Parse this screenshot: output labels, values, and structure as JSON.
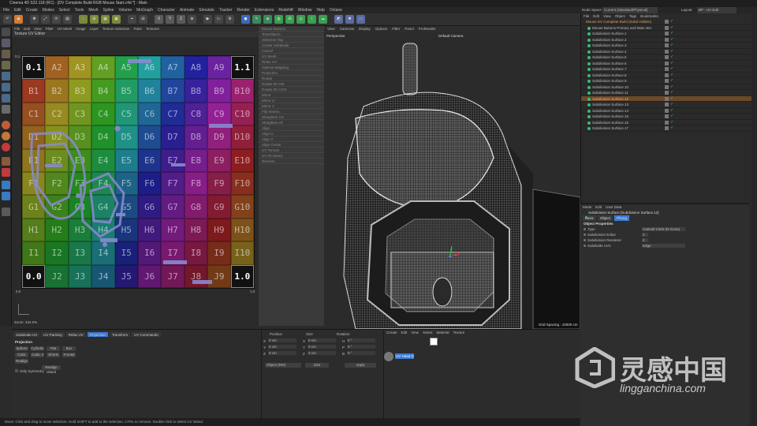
{
  "window": {
    "title": "Cinema 4D S22.118 (RC) - [DV Complete Build RGB Mouse Start.c4d *] - Main"
  },
  "menu": [
    "File",
    "Edit",
    "Create",
    "Modes",
    "Select",
    "Tools",
    "Mesh",
    "Spline",
    "Volume",
    "MoGraph",
    "Character",
    "Animate",
    "Simulate",
    "Tracker",
    "Render",
    "Extensions",
    "Redshift",
    "Window",
    "Help",
    "Octane"
  ],
  "layout": {
    "node_space_label": "Node Space",
    "node_space_value": "Current (Standard/Physical)",
    "layout_label": "Layout",
    "layout_value": "BP - UV Edit"
  },
  "toolbar": {
    "x": "X",
    "y": "Y",
    "z": "Z"
  },
  "uv_editor": {
    "menu": [
      "File",
      "Edit",
      "View",
      "Filter",
      "UV Mesh",
      "Image",
      "Layer",
      "Texture Selection",
      "Paint",
      "Textures"
    ],
    "title": "Texture UV Editor",
    "rows": [
      [
        "0.1",
        "A2",
        "A3",
        "A4",
        "A5",
        "A6",
        "A7",
        "A8",
        "A9",
        "1.1"
      ],
      [
        "B1",
        "B2",
        "B3",
        "B4",
        "B5",
        "B6",
        "B7",
        "B8",
        "B9",
        "B10"
      ],
      [
        "C1",
        "C2",
        "C3",
        "C4",
        "C5",
        "C6",
        "C7",
        "C8",
        "C9",
        "C10"
      ],
      [
        "D1",
        "D2",
        "D3",
        "D4",
        "D5",
        "D6",
        "D7",
        "D8",
        "D9",
        "D10"
      ],
      [
        "E1",
        "E2",
        "E3",
        "E4",
        "E5",
        "E6",
        "E7",
        "E8",
        "E9",
        "E10"
      ],
      [
        "F1",
        "F2",
        "F3",
        "F4",
        "F5",
        "F6",
        "F7",
        "F8",
        "F9",
        "F10"
      ],
      [
        "G1",
        "G2",
        "G3",
        "G4",
        "G5",
        "G6",
        "G7",
        "G8",
        "G9",
        "G10"
      ],
      [
        "H1",
        "H2",
        "H3",
        "H4",
        "H5",
        "H6",
        "H7",
        "H8",
        "H9",
        "H10"
      ],
      [
        "I1",
        "I2",
        "I3",
        "I4",
        "I5",
        "I6",
        "I7",
        "I8",
        "I9",
        "I10"
      ],
      [
        "0.0",
        "J2",
        "J3",
        "J4",
        "J5",
        "J6",
        "J7",
        "J8",
        "J9",
        "1.0"
      ]
    ],
    "axis": {
      "top_left": "0,1",
      "bottom_left": "0,0",
      "bottom_right": "1,0",
      "top_right": "1,1"
    },
    "zoom": "Zoom: 234.0%"
  },
  "mid_panel": {
    "items": [
      "Mouse Buttons",
      "Tessellation",
      "Selection Tag",
      "Create Subdivide",
      "Cancel",
      "UV Mesh",
      "Relax UV",
      "Optimal Mapping",
      "Projection",
      "Rotate",
      "Rotate 90 CW",
      "Rotate 90 CCW",
      "Mirror",
      "Mirror U",
      "Mirror V",
      "Flip Seams",
      "Straighten UV",
      "Straighten All",
      "Align",
      "Align U",
      "Align V",
      "Align Center",
      "UV Terrace",
      "UV Fit Island",
      "Reverse"
    ]
  },
  "viewport": {
    "menu": [
      "View",
      "Cameras",
      "Display",
      "Options",
      "Filter",
      "Panel",
      "ProRender"
    ],
    "label": "Perspective",
    "camera": "Default Camera",
    "grid": "Grid Spacing : 10000 cm"
  },
  "objects": {
    "menu": [
      "File",
      "Edit",
      "View",
      "Object",
      "Tags",
      "Bookmarks"
    ],
    "rows": [
      "Mouse DV Complete Build (Subd Hidden)",
      "Mouse Buttons Primary and Main ster",
      "Subdivision Surface.1",
      "Subdivision Surface.2",
      "Subdivision Surface.3",
      "Subdivision Surface.4",
      "Subdivision Surface.5",
      "Subdivision Surface.6",
      "Subdivision Surface.7",
      "Subdivision Surface.8",
      "Subdivision Surface.9",
      "Subdivision Surface.10",
      "Subdivision Surface.11",
      "Subdivision Surface.12",
      "Subdivision Surface.13",
      "Subdivision Surface.14",
      "Subdivision Surface.15",
      "Subdivision Surface.16",
      "Subdivision Surface.17"
    ],
    "selected_index": 13
  },
  "attributes": {
    "menu": [
      "Mode",
      "Edit",
      "User Data"
    ],
    "header": "Subdivision Surface [Subdivision Surface.12]",
    "tabs": [
      "Basic",
      "Object",
      "Phong"
    ],
    "active_tab": "Phong",
    "section": "Object Properties",
    "props": [
      {
        "label": "Type",
        "value": "Catmull-Clark (N-Gons)"
      },
      {
        "label": "Subdivision Editor",
        "value": "2"
      },
      {
        "label": "Subdivision Renderer",
        "value": "2"
      },
      {
        "label": "Subdivide UVs",
        "value": "Edge"
      }
    ]
  },
  "uv_tabs": {
    "items": [
      "Subdivide UV",
      "UV Packing",
      "Relax UV",
      "Projection",
      "Transform",
      "UV Commands"
    ],
    "active": "Projection",
    "section": "Projection",
    "buttons": [
      "Sphere",
      "Cylinder",
      "Flat",
      "Box",
      "Cubic",
      "Cubic 2",
      "Shrink",
      "Frontal",
      "Realign"
    ],
    "checkbox": "Only Symmetry",
    "pack_label": "Realign Island"
  },
  "coords": {
    "headers": [
      "Position",
      "Size",
      "Rotation"
    ],
    "rows": [
      [
        "X",
        "0 cm",
        "X",
        "0 cm",
        "H",
        "0 °"
      ],
      [
        "Y",
        "0 cm",
        "Y",
        "0 cm",
        "P",
        "0 °"
      ],
      [
        "Z",
        "0 cm",
        "Z",
        "0 cm",
        "B",
        "0 °"
      ]
    ],
    "mode": "Object (Rel)",
    "size_mode": "Size",
    "apply": "Apply"
  },
  "material": {
    "menu": [
      "Create",
      "Edit",
      "View",
      "Select",
      "Material",
      "Texture"
    ],
    "name": "UV Head D"
  },
  "status": "Move: Click and drag to move selection. Hold SHIFT to add to the selection, CTRL to remove. Double-click to select UV Island.",
  "watermark": {
    "text": "灵感中国",
    "url": "lingganchina.com"
  },
  "colors": {
    "accent": "#3a7bd5",
    "selected_row": "#6a4a2a",
    "green": "#3cba7a"
  }
}
